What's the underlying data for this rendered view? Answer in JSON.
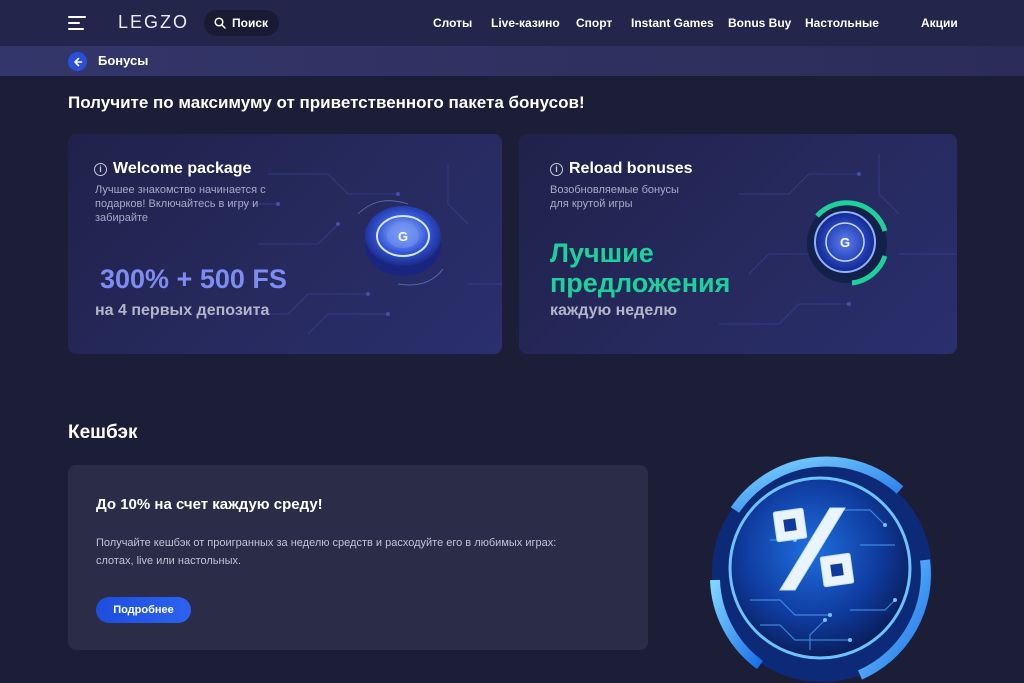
{
  "header": {
    "logo": "LEGZO",
    "search_label": "Поиск",
    "nav": [
      "Слоты",
      "Live-казино",
      "Спорт",
      "Instant Games",
      "Bonus Buy",
      "Настольные",
      "Акции"
    ]
  },
  "breadcrumb": {
    "label": "Бонусы"
  },
  "main": {
    "title": "Получите по максимуму от приветственного пакета бонусов!",
    "cards": [
      {
        "title": "Welcome package",
        "desc_lines": [
          "Лучшее знакомство начинается с",
          "подарков! Включайтесь в игру и",
          "забирайте"
        ],
        "highlight": "300% + 500 FS",
        "sub": "на 4 первых депозита"
      },
      {
        "title": "Reload bonuses",
        "desc_lines": [
          "Возобновляемые бонусы",
          "для крутой игры"
        ],
        "highlight_lines": [
          "Лучшие",
          "предложения"
        ],
        "sub": "каждую неделю"
      }
    ]
  },
  "cashback": {
    "section_title": "Кешбэк",
    "heading": "До 10% на счет каждую среду!",
    "text_lines": [
      "Получайте кешбэк от проигранных за неделю средств и расходуйте его в любимых играх:",
      "слотах, live или настольных."
    ],
    "button": "Подробнее"
  },
  "icons": {
    "menu": "hamburger-menu-icon",
    "search": "search-icon",
    "back": "arrow-left-icon",
    "info": "info-icon"
  },
  "colors": {
    "accent": "#2a4fd8",
    "green": "#1ed09b",
    "blue_highlight": "#7e8cf2",
    "background": "#1c1d36"
  }
}
